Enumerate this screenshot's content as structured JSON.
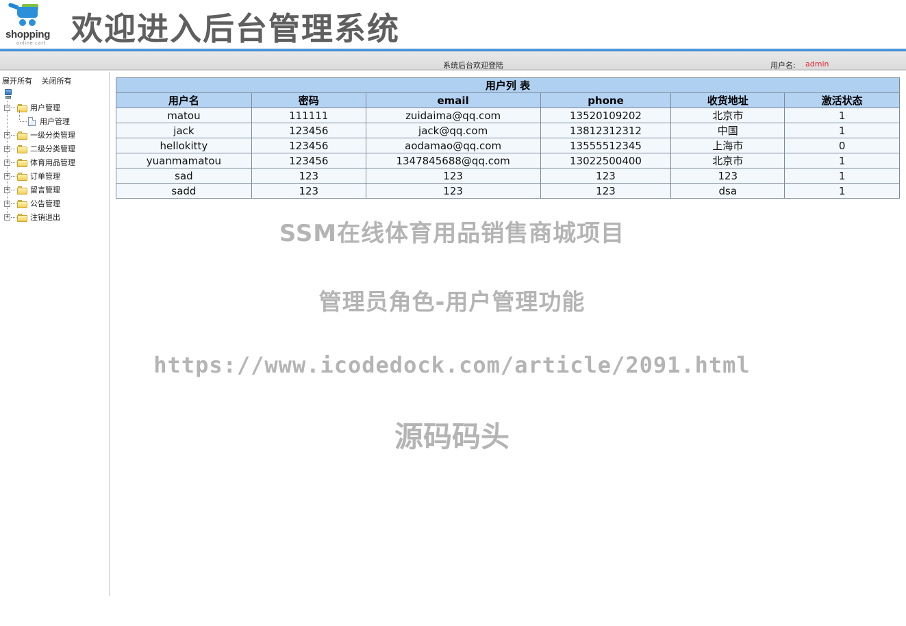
{
  "header": {
    "logo_text": "shopping",
    "logo_sub": "online cart",
    "title": "欢迎进入后台管理系统"
  },
  "topbar": {
    "welcome": "系统后台欢迎登陆",
    "user_label": "用户名:",
    "user_name": "admin",
    "user_name_color": "#e0202a"
  },
  "sidebar": {
    "expand_all": "展开所有",
    "collapse_all": "关闭所有",
    "root_icon": "computer-icon",
    "items": [
      {
        "label": "用户管理",
        "expanded": true,
        "children": [
          {
            "label": "用户管理"
          }
        ]
      },
      {
        "label": "一级分类管理",
        "expanded": false
      },
      {
        "label": "二级分类管理",
        "expanded": false
      },
      {
        "label": "体育用品管理",
        "expanded": false
      },
      {
        "label": "订单管理",
        "expanded": false
      },
      {
        "label": "留言管理",
        "expanded": false
      },
      {
        "label": "公告管理",
        "expanded": false
      },
      {
        "label": "注销退出",
        "expanded": false
      }
    ]
  },
  "table": {
    "caption": "用户列 表",
    "columns": [
      "用户名",
      "密码",
      "email",
      "phone",
      "收货地址",
      "激活状态"
    ],
    "rows": [
      [
        "matou",
        "111111",
        "zuidaima@qq.com",
        "13520109202",
        "北京市",
        "1"
      ],
      [
        "jack",
        "123456",
        "jack@qq.com",
        "13812312312",
        "中国",
        "1"
      ],
      [
        "hellokitty",
        "123456",
        "aodamao@qq.com",
        "13555512345",
        "上海市",
        "0"
      ],
      [
        "yuanmamatou",
        "123456",
        "1347845688@qq.com",
        "13022500400",
        "北京市",
        "1"
      ],
      [
        "sad",
        "123",
        "123",
        "123",
        "123",
        "1"
      ],
      [
        "sadd",
        "123",
        "123",
        "123",
        "dsa",
        "1"
      ]
    ]
  },
  "watermark": {
    "line1": "SSM在线体育用品销售商城项目",
    "line2": "管理员角色-用户管理功能",
    "line3": "https://www.icodedock.com/article/2091.html",
    "line4": "源码码头"
  }
}
